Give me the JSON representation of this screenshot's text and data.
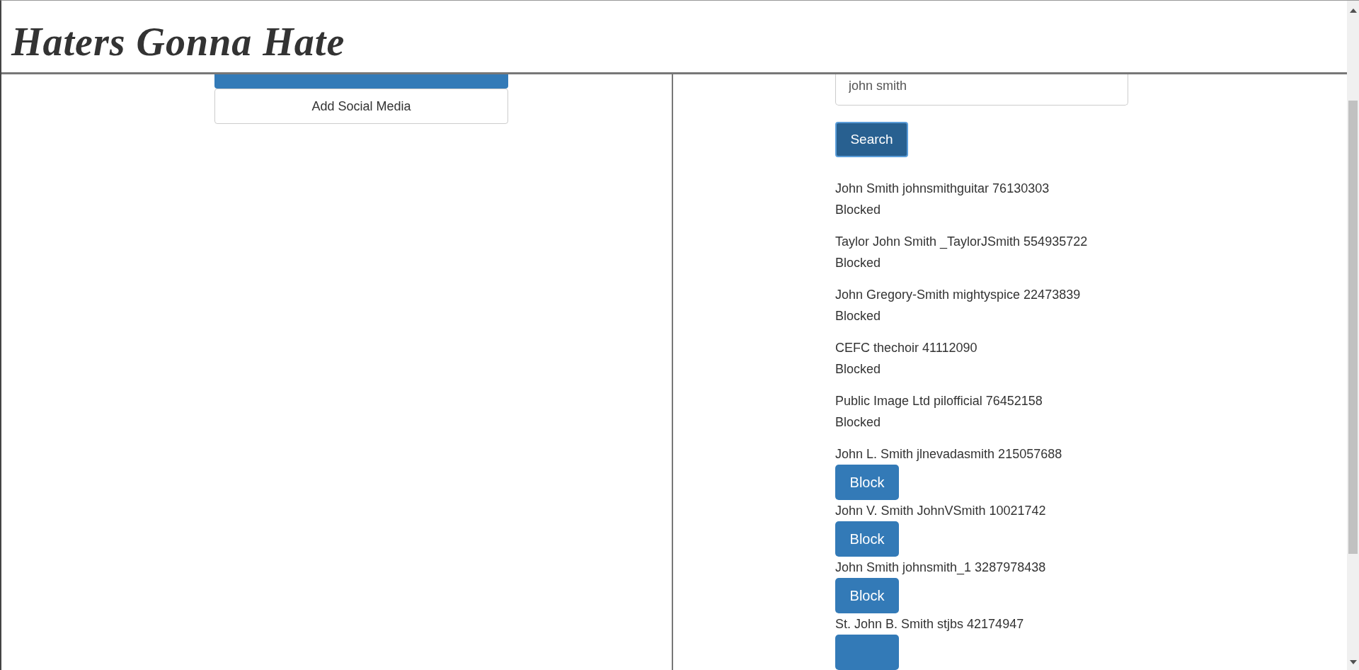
{
  "header": {
    "title": "Haters Gonna Hate"
  },
  "left_panel": {
    "buttons": [
      {
        "kind": "primary-cut"
      },
      {
        "kind": "default",
        "label": "Add Social Media"
      }
    ]
  },
  "search": {
    "value": "john smith",
    "button": "Search"
  },
  "results": [
    {
      "text": "John Smith johnsmithguitar 76130303",
      "blocked": true,
      "status": "Blocked"
    },
    {
      "text": "Taylor John Smith _TaylorJSmith 554935722",
      "blocked": true,
      "status": "Blocked"
    },
    {
      "text": "John Gregory-Smith mightyspice 22473839",
      "blocked": true,
      "status": "Blocked"
    },
    {
      "text": "CEFC thechoir 41112090",
      "blocked": true,
      "status": "Blocked"
    },
    {
      "text": "Public Image Ltd pilofficial 76452158",
      "blocked": true,
      "status": "Blocked"
    },
    {
      "text": "John L. Smith jlnevadasmith 215057688",
      "blocked": false,
      "action": "Block"
    },
    {
      "text": "John V. Smith JohnVSmith 10021742",
      "blocked": false,
      "action": "Block"
    },
    {
      "text": "John Smith johnsmith_1 3287978438",
      "blocked": false,
      "action": "Block"
    },
    {
      "text": "St. John B. Smith stjbs 42174947",
      "blocked": false
    }
  ]
}
